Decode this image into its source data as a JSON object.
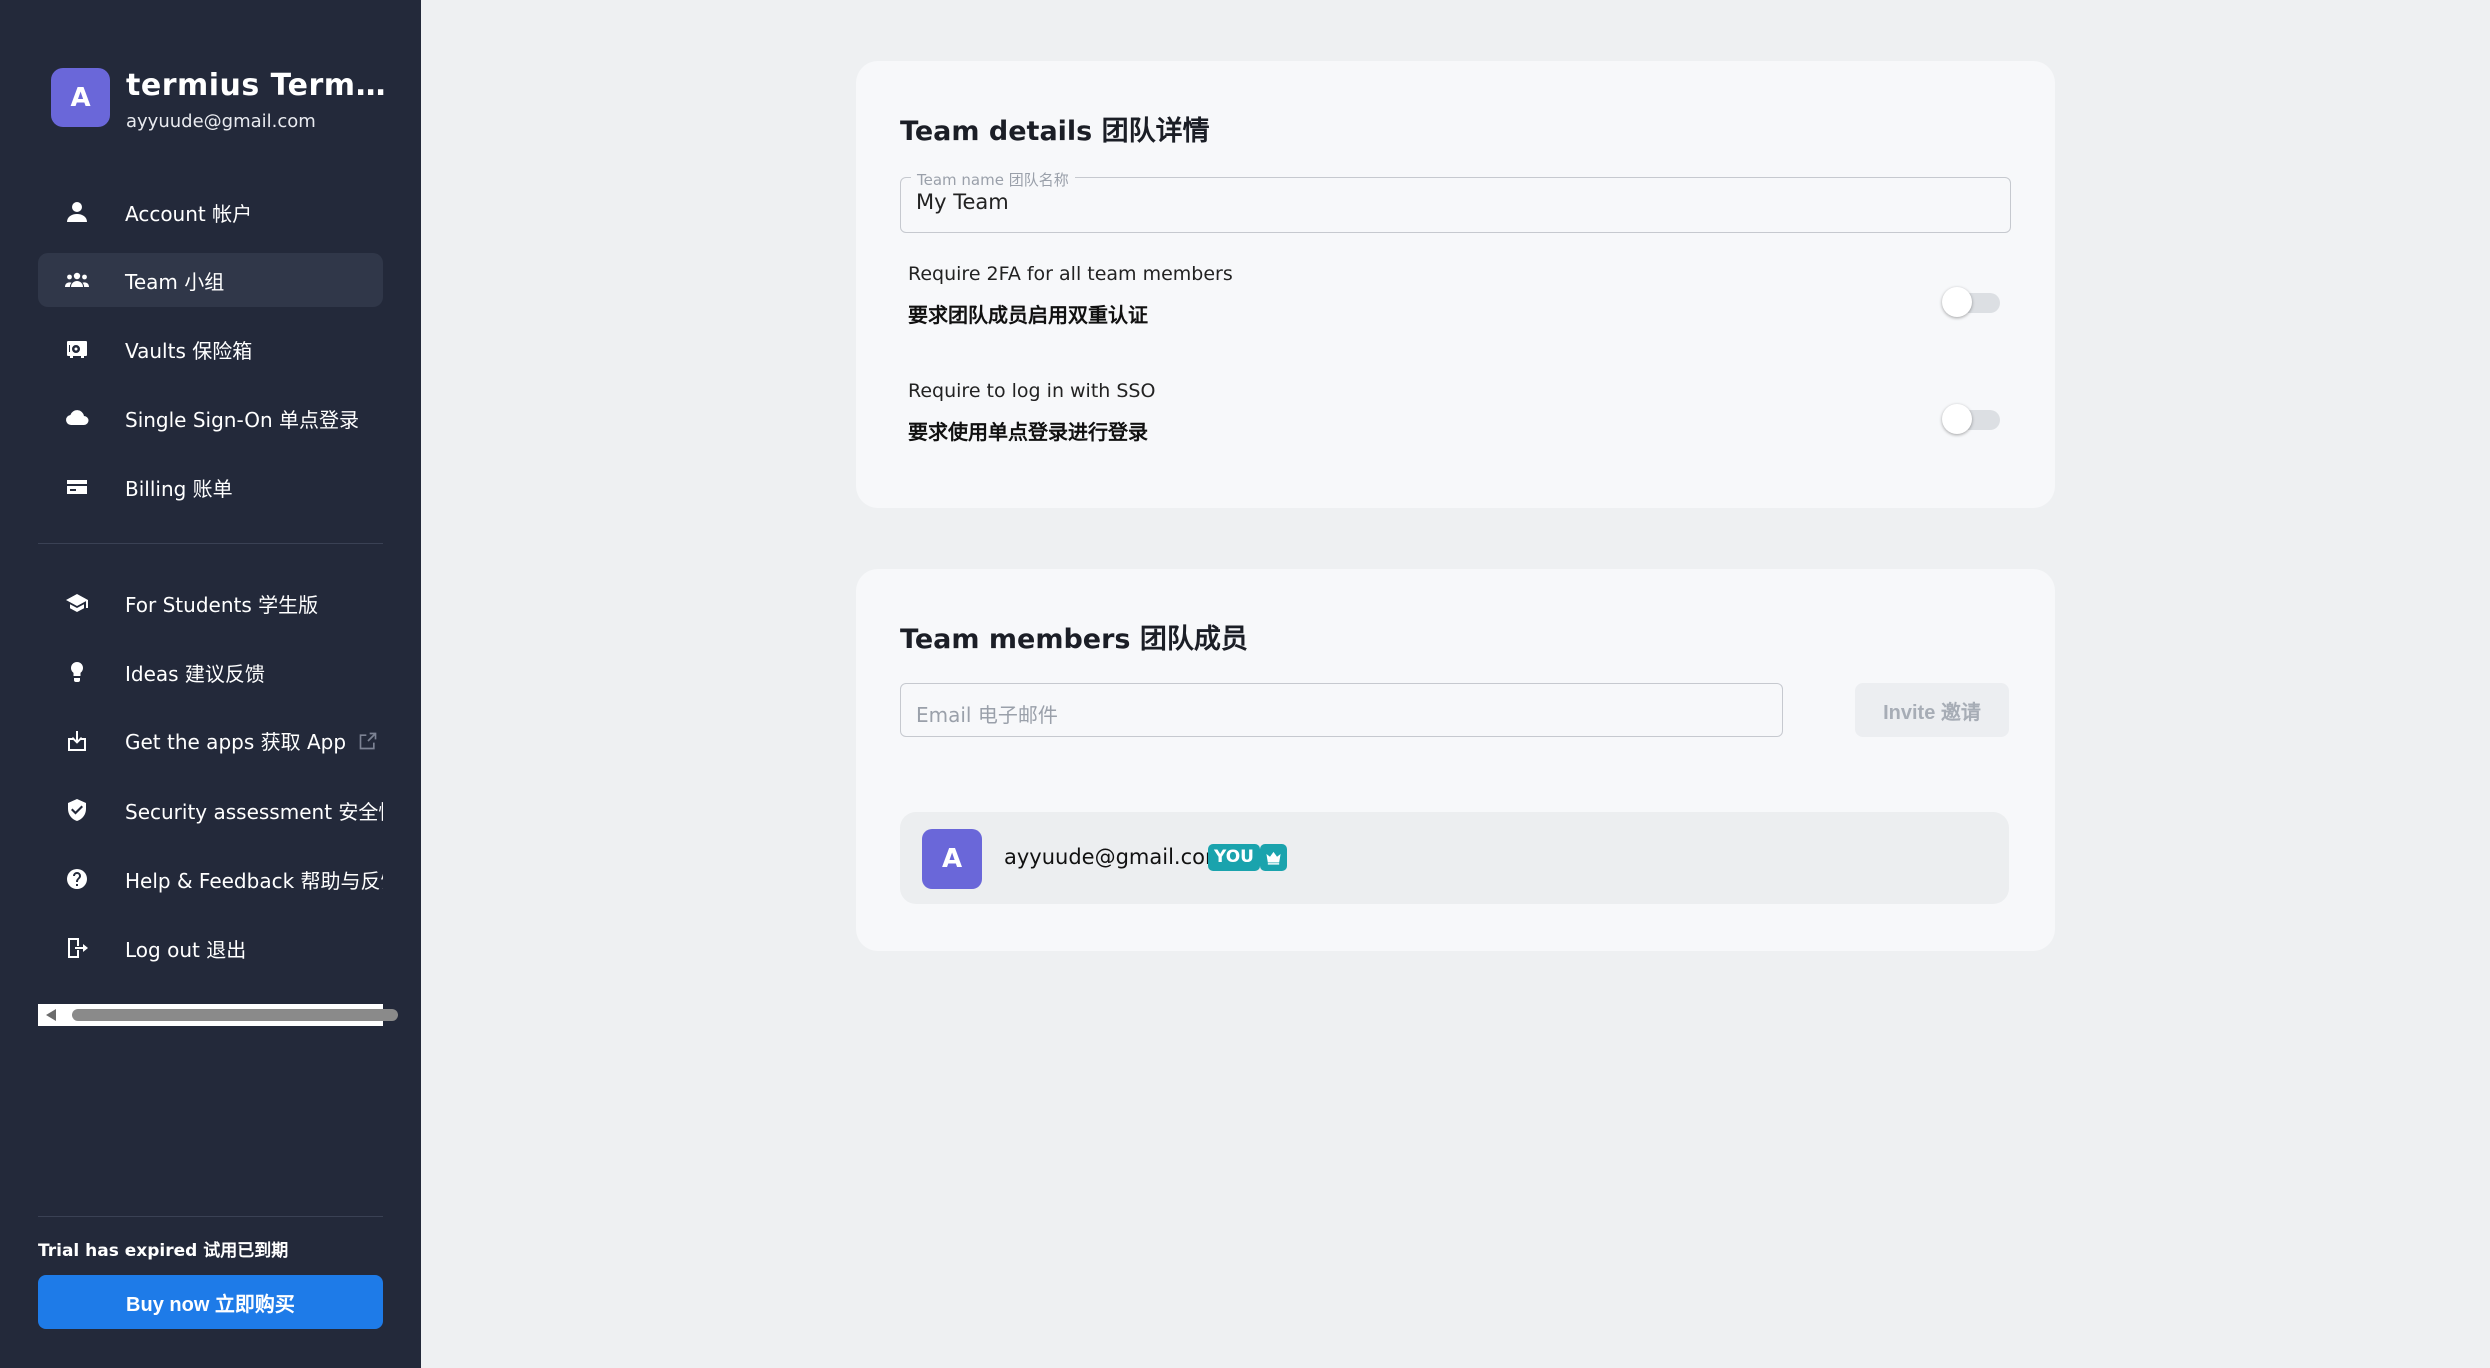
{
  "profile": {
    "avatar_letter": "A",
    "title": "termius  Termius",
    "email": "ayyuude@gmail.com"
  },
  "nav_primary": [
    {
      "label": "Account  帐户",
      "icon": "person-icon"
    },
    {
      "label": "Team  小组",
      "icon": "team-icon",
      "active": true
    },
    {
      "label": "Vaults  保险箱",
      "icon": "vault-icon"
    },
    {
      "label": "Single Sign-On  单点登录",
      "icon": "cloud-icon"
    },
    {
      "label": "Billing  账单",
      "icon": "credit-card-icon"
    }
  ],
  "nav_secondary": [
    {
      "label": "For Students  学生版",
      "icon": "graduation-cap-icon"
    },
    {
      "label": "Ideas  建议反馈",
      "icon": "lightbulb-icon"
    },
    {
      "label": "Get the apps  获取 App",
      "icon": "download-icon",
      "external": true
    },
    {
      "label": "Security assessment  安全性评估",
      "icon": "shield-icon"
    },
    {
      "label": "Help & Feedback  帮助与反馈",
      "icon": "help-icon"
    },
    {
      "label": "Log out  退出",
      "icon": "logout-icon"
    }
  ],
  "trial": {
    "status": "Trial has expired  试用已到期",
    "buy_label": "Buy now  立即购买"
  },
  "team_details": {
    "title": "Team details  团队详情",
    "team_name_label": "Team name  团队名称",
    "team_name_value": "My Team",
    "require_2fa_en": "Require 2FA for all team members",
    "require_2fa_zh": "要求团队成员启用双重认证",
    "require_2fa_enabled": false,
    "require_sso_en": "Require to log in with SSO",
    "require_sso_zh": "要求使用单点登录进行登录",
    "require_sso_enabled": false
  },
  "team_members": {
    "title": "Team members  团队成员",
    "email_placeholder": "Email  电子邮件",
    "invite_label": "Invite  邀请",
    "members": [
      {
        "avatar_letter": "A",
        "email": "ayyuude@gmail.com",
        "you_badge": "YOU",
        "role_icon": "crown-icon"
      }
    ]
  },
  "colors": {
    "sidebar_bg": "#23293a",
    "accent_blue": "#1e7be8",
    "avatar_purple": "#6a67d9",
    "badge_teal": "#1aa3ad"
  }
}
